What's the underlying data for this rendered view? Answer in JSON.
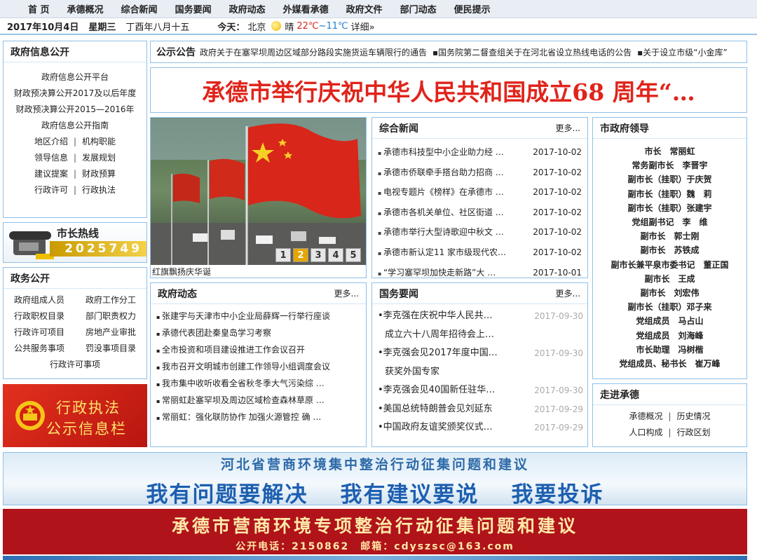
{
  "nav": [
    "首 页",
    "承德概况",
    "综合新闻",
    "国务要闻",
    "政府动态",
    "外媒看承德",
    "政府文件",
    "部门动态",
    "便民提示"
  ],
  "datebar": {
    "date": "2017年10月4日",
    "weekday": "星期三",
    "lunar": "丁酉年八月十五",
    "today_label": "今天：",
    "city": "北京",
    "weather": "晴",
    "temp_high": "22℃",
    "temp_sep": "~",
    "temp_low": "11℃",
    "detail": "详细»"
  },
  "info_open": {
    "title": "政府信息公开",
    "items": [
      "政府信息公开平台",
      "财政预决算公开2017及以后年度",
      "财政预决算公开2015—2016年",
      "政府信息公开指南"
    ],
    "pairs": [
      [
        "地区介绍",
        "机构职能"
      ],
      [
        "领导信息",
        "发展规划"
      ],
      [
        "建议提案",
        "财政预算"
      ],
      [
        "行政许可",
        "行政执法"
      ]
    ]
  },
  "hotline": {
    "title": "市长热线",
    "number": "2025749"
  },
  "affairs": {
    "title": "政务公开",
    "pairs": [
      [
        "政府组成人员",
        "政府工作分工"
      ],
      [
        "行政职权目录",
        "部门职责权力"
      ],
      [
        "行政许可项目",
        "房地产业审批"
      ],
      [
        "公共服务事项",
        "罚没事项目录"
      ]
    ],
    "last": "行政许可事项"
  },
  "law_banner": {
    "line1": "行政执法",
    "line2": "公示信息栏"
  },
  "notice": {
    "label": "公示公告",
    "items": [
      "政府关于在塞罕坝周边区域部分路段实施货运车辆限行的通告",
      "▪国务院第二督查组关于在河北省设立热线电话的公告",
      "▪关于设立市级“小金库”"
    ]
  },
  "headline": "承德市举行庆祝中华人民共和国成立68 周年“…",
  "slideshow": {
    "caption": "红旗飘扬庆华诞",
    "pages": [
      "1",
      "2",
      "3",
      "4",
      "5"
    ],
    "active": "2"
  },
  "news": {
    "title": "综合新闻",
    "more": "更多...",
    "items": [
      {
        "t": "承德市科技型中小企业助力经 …",
        "d": "2017-10-02"
      },
      {
        "t": "承德市侨联牵手搭台助力招商 …",
        "d": "2017-10-02"
      },
      {
        "t": "电视专题片《榜样》在承德市 …",
        "d": "2017-10-02"
      },
      {
        "t": "承德市各机关单位、社区街道 …",
        "d": "2017-10-02"
      },
      {
        "t": "承德市举行大型诗歌迎中秋文 …",
        "d": "2017-10-02"
      },
      {
        "t": "承德市新认定11 家市级现代农…",
        "d": "2017-10-02"
      },
      {
        "t": "“学习塞罕坝加快走新路”大 …",
        "d": "2017-10-01"
      }
    ]
  },
  "leaders": {
    "title": "市政府领导",
    "items": [
      "市长　常丽虹",
      "常务副市长　李晋宇",
      "副市长（挂职）于庆贺",
      "副市长（挂职）魏　莉",
      "副市长（挂职）张建宇",
      "党组副书记　李　维",
      "副市长　郭士刚",
      "副市长　苏铁成",
      "副市长兼平泉市委书记　董正国",
      "副市长　王成",
      "副市长　刘宏伟",
      "副市长（挂职）邓子来",
      "党组成员　马占山",
      "党组成员　刘海峰",
      "市长助理　冯树楷",
      "党组成员、秘书长　崔万峰"
    ]
  },
  "gov_news": {
    "title": "政府动态",
    "more": "更多...",
    "items": [
      "张建宇与天津市中小企业局薛辉一行举行座谈",
      "承德代表团赴秦皇岛学习考察",
      "全市投资和项目建设推进工作会议召开",
      "我市召开文明城市创建工作领导小组调度会议",
      "我市集中收听收看全省秋冬季大气污染综 …",
      "常丽虹赴塞罕坝及周边区域检查森林草原 …",
      "常丽虹：强化联防协作 加强火源管控 确 …"
    ]
  },
  "state_news": {
    "title": "国务要闻",
    "more": "更多...",
    "items": [
      {
        "t": "•李克强在庆祝中华人民共…",
        "d": "2017-09-30"
      },
      {
        "t": "成立六十八周年招待会上…",
        "d": ""
      },
      {
        "t": "•李克强会见2017年度中国…",
        "d": "2017-09-30"
      },
      {
        "t": "获奖外国专家",
        "d": ""
      },
      {
        "t": "•李克强会见40国新任驻华…",
        "d": "2017-09-30"
      },
      {
        "t": "•美国总统特朗普会见刘延东",
        "d": "2017-09-29"
      },
      {
        "t": "•中国政府友谊奖颁奖仪式…",
        "d": "2017-09-29"
      }
    ]
  },
  "chengde": {
    "title": "走进承德",
    "pairs": [
      [
        "承德概况",
        "历史情况"
      ],
      [
        "人口构成",
        "行政区划"
      ]
    ]
  },
  "banner1": {
    "line1": "河北省营商环境集中整治行动征集问题和建议",
    "line2": [
      "我有问题要解决",
      "我有建议要说",
      "我要投诉"
    ]
  },
  "banner2": {
    "line1": "承德市营商环境专项整治行动征集问题和建议",
    "line2": "公开电话：2150862　邮箱：cdyszsc@163.com"
  },
  "colors": {
    "accent_blue": "#8fc0e8",
    "headline_red": "#e0241b",
    "banner_red": "#b0131a"
  }
}
